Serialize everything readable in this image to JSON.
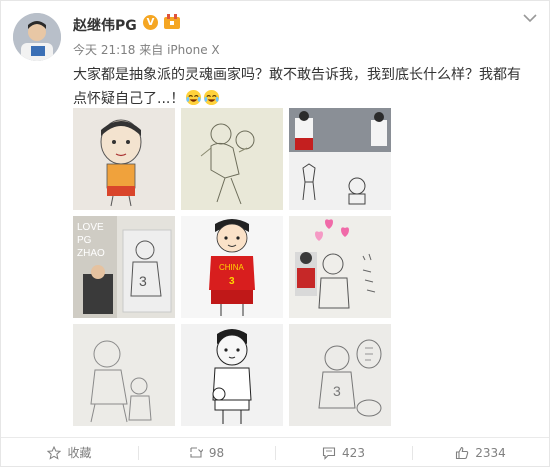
{
  "post": {
    "author": "赵继伟PG",
    "verified_badge": "V",
    "time": "今天 21:18",
    "source_prefix": "来自",
    "source": "iPhone X",
    "text": "大家都是抽象派的灵魂画家吗？敢不敢告诉我，我到底长什么样？我都有点怀疑自己了...！",
    "emoji": "laugh-cry-emoji"
  },
  "images": [
    {
      "id": "img-1",
      "desc": "cartoon-drawing"
    },
    {
      "id": "img-2",
      "desc": "pencil-sketch"
    },
    {
      "id": "img-3",
      "desc": "photo-with-drawing"
    },
    {
      "id": "img-4",
      "text_lines": [
        "LOVE",
        "PG",
        "ZHAO"
      ]
    },
    {
      "id": "img-5",
      "jersey_text": "CHINA"
    },
    {
      "id": "img-6",
      "desc": "sketch-with-hearts"
    },
    {
      "id": "img-7",
      "desc": "pencil-sketch"
    },
    {
      "id": "img-8",
      "desc": "cartoon-drawing"
    },
    {
      "id": "img-9",
      "desc": "pencil-sketch"
    }
  ],
  "actions": {
    "favorite_label": "收藏",
    "repost_count": "98",
    "comment_count": "423",
    "like_count": "2334"
  },
  "colors": {
    "accent_orange": "#f5a623",
    "text_gray": "#808080",
    "jersey_red": "#d81e1e"
  }
}
